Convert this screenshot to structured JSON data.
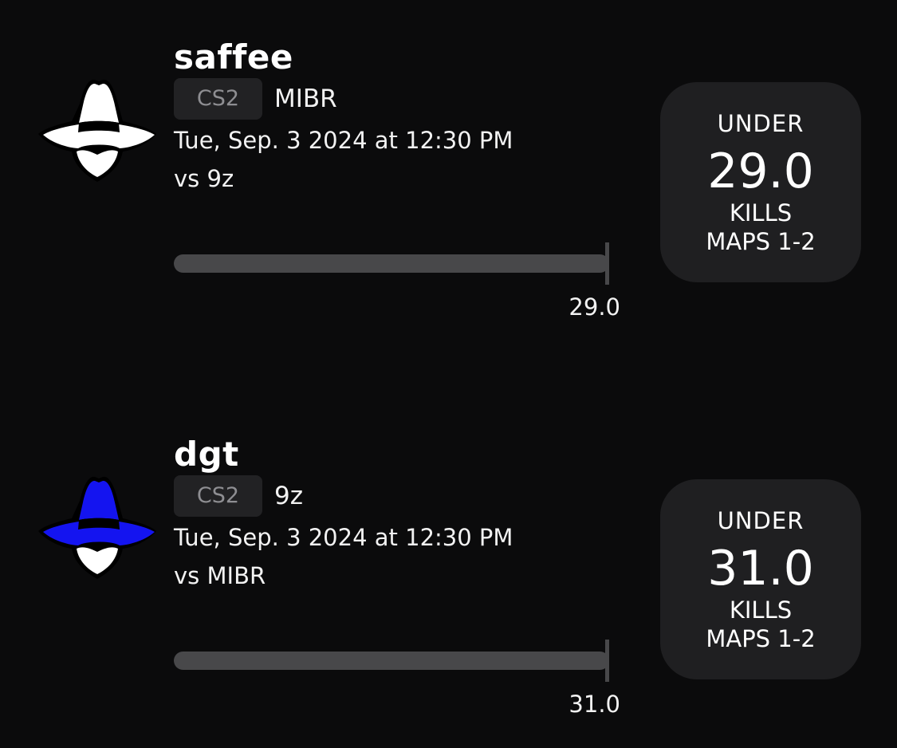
{
  "props": [
    {
      "player": "saffee",
      "avatar_icon": "spy-hat-icon",
      "hat_color": "#ffffff",
      "game": "CS2",
      "team": "MIBR",
      "datetime": "Tue, Sep. 3 2024 at 12:30 PM",
      "opponent": "vs 9z",
      "line_label": "29.0",
      "direction": "UNDER",
      "line_value": "29.0",
      "stat": "KILLS",
      "scope": "MAPS 1-2"
    },
    {
      "player": "dgt",
      "avatar_icon": "spy-hat-icon",
      "hat_color": "#1414f0",
      "game": "CS2",
      "team": "9z",
      "datetime": "Tue, Sep. 3 2024 at 12:30 PM",
      "opponent": "vs MIBR",
      "line_label": "31.0",
      "direction": "UNDER",
      "line_value": "31.0",
      "stat": "KILLS",
      "scope": "MAPS 1-2"
    }
  ]
}
